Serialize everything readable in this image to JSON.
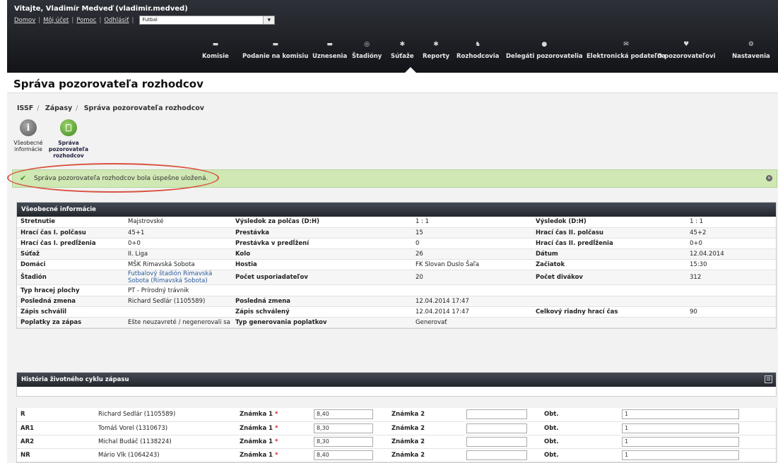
{
  "header": {
    "welcome": "Vitajte, Vladimír Medveď (vladimir.medved)",
    "links": [
      "Domov",
      "Môj účet",
      "Pomoc",
      "Odhlásiť"
    ],
    "sport_select": "Futbal"
  },
  "nav": [
    {
      "label": "Komisie",
      "icon": "folder-icon"
    },
    {
      "label": "Podanie na komisiu",
      "icon": "folder-icon"
    },
    {
      "label": "Uznesenia",
      "icon": "folder-icon"
    },
    {
      "label": "Štadióny",
      "icon": "stadium-icon"
    },
    {
      "label": "Súťaže",
      "icon": "players-icon"
    },
    {
      "label": "Reporty",
      "icon": "players-icon"
    },
    {
      "label": "Rozhodcovia",
      "icon": "referee-icon"
    },
    {
      "label": "Delegáti pozorovatelia",
      "icon": "ball-icon"
    },
    {
      "label": "Elektronická podateľna",
      "icon": "mail-icon"
    },
    {
      "label": "O pozorovateľovi",
      "icon": "pin-icon"
    },
    {
      "label": "Nastavenia",
      "icon": "settings-icon"
    }
  ],
  "page_title": "Správa pozorovateľa rozhodcov",
  "breadcrumb": [
    "ISSF",
    "Zápasy",
    "Správa pozorovateľa rozhodcov"
  ],
  "quick_links": {
    "info": "Všeobecné informácie",
    "report": "Správa pozorovateľa rozhodcov"
  },
  "alert": "Správa pozorovateľa rozhodcov bola úspešne uložená.",
  "general": {
    "title": "Všeobecné informácie",
    "rows": [
      [
        "Stretnutie",
        "Majstrovské",
        "Výsledok za polčas (D:H)",
        "1 : 1",
        "Výsledok (D:H)",
        "1 : 1"
      ],
      [
        "Hrací čas I. polčasu",
        "45+1",
        "Prestávka",
        "15",
        "Hrací čas II. polčasu",
        "45+2"
      ],
      [
        "Hrací čas I. predĺženia",
        "0+0",
        "Prestávka v predĺžení",
        "0",
        "Hrací čas II. predĺženia",
        "0+0"
      ],
      [
        "Súťaž",
        "II. Liga",
        "Kolo",
        "26",
        "Dátum",
        "12.04.2014"
      ],
      [
        "Domáci",
        "MŠK Rimavská Sobota",
        "Hostia",
        "FK Slovan Duslo Šaľa",
        "Začiatok",
        "15:30"
      ],
      [
        "Štadión",
        "Futbalový štadión Rimavská Sobota (Rimavská Sobota)",
        "Počet usporiadateľov",
        "20",
        "Počet divákov",
        "312"
      ],
      [
        "Typ hracej plochy",
        "PT - Prírodný trávnik",
        "",
        "",
        "",
        ""
      ],
      [
        "Posledná zmena",
        "Richard Sedlár (1105589)",
        "Posledná zmena",
        "12.04.2014 17:47",
        "",
        ""
      ],
      [
        "Zápis schválil",
        "",
        "Zápis schválený",
        "12.04.2014 17:47",
        "Celkový riadny hrací čas",
        "90"
      ],
      [
        "Poplatky za zápas",
        "Ešte neuzavreté / negenerovali sa",
        "Typ generovania poplatkov",
        "Generovať",
        "",
        ""
      ]
    ]
  },
  "history": {
    "title": "História životného cyklu zápasu"
  },
  "referees": {
    "mark1_label": "Známka 1",
    "mark2_label": "Známka 2",
    "obt_label": "Obt.",
    "rows": [
      {
        "role": "R",
        "name": "Richard Sedlár (1105589)",
        "mark1": "8,40",
        "mark2": "",
        "obt": "1"
      },
      {
        "role": "AR1",
        "name": "Tomáš Vorel (1310673)",
        "mark1": "8,30",
        "mark2": "",
        "obt": "1"
      },
      {
        "role": "AR2",
        "name": "Michal Budáč (1138224)",
        "mark1": "8,30",
        "mark2": "",
        "obt": "1"
      },
      {
        "role": "NR",
        "name": "Mário Vlk (1064243)",
        "mark1": "8,40",
        "mark2": "",
        "obt": "1"
      }
    ]
  }
}
